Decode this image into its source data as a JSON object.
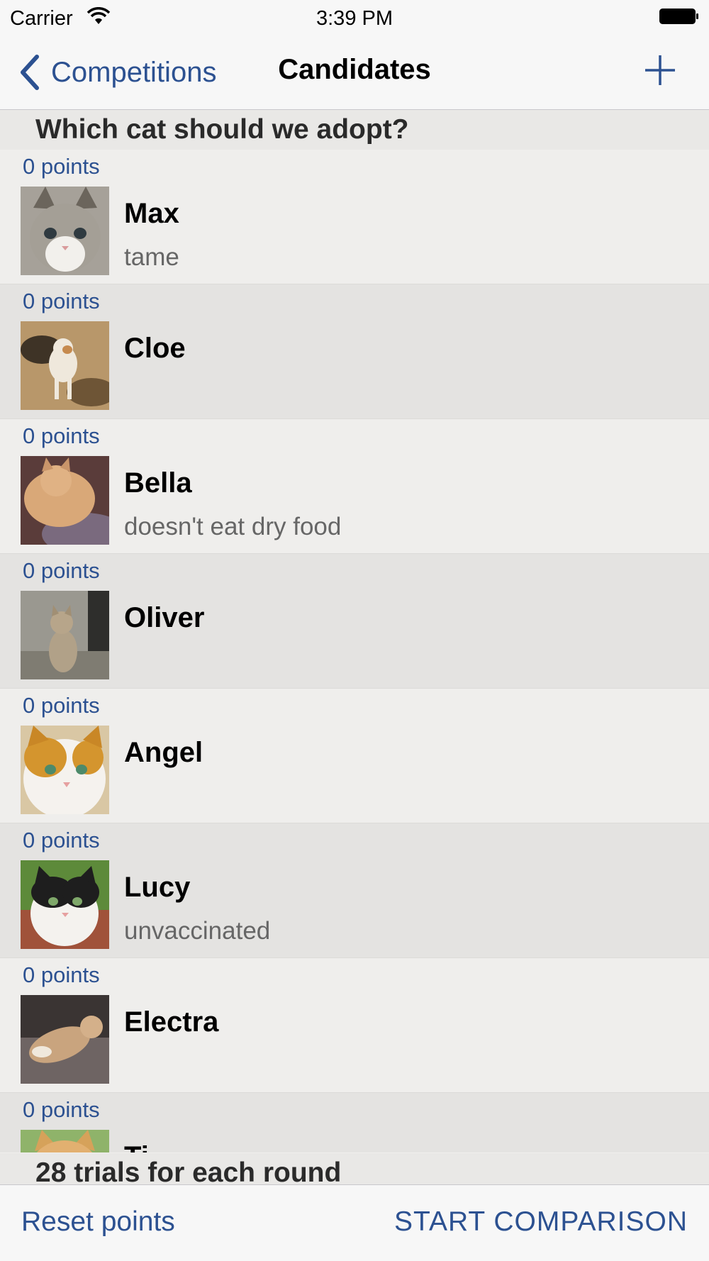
{
  "status_bar": {
    "carrier": "Carrier",
    "time": "3:39 PM"
  },
  "nav": {
    "back_label": "Competitions",
    "title": "Candidates",
    "add_icon": "plus-icon"
  },
  "section": {
    "title": "Which cat should we adopt?"
  },
  "candidates": [
    {
      "points": "0 points",
      "name": "Max",
      "note": "tame"
    },
    {
      "points": "0 points",
      "name": "Cloe",
      "note": ""
    },
    {
      "points": "0 points",
      "name": "Bella",
      "note": "doesn't eat dry food"
    },
    {
      "points": "0 points",
      "name": "Oliver",
      "note": ""
    },
    {
      "points": "0 points",
      "name": "Angel",
      "note": ""
    },
    {
      "points": "0 points",
      "name": "Lucy",
      "note": "unvaccinated"
    },
    {
      "points": "0 points",
      "name": "Electra",
      "note": ""
    },
    {
      "points": "0 points",
      "name": "Ti",
      "note": ""
    }
  ],
  "footer": {
    "trials_text": "28 trials for each round"
  },
  "toolbar": {
    "reset_label": "Reset points",
    "start_label": "START COMPARISON"
  },
  "colors": {
    "accent": "#2c5191"
  }
}
